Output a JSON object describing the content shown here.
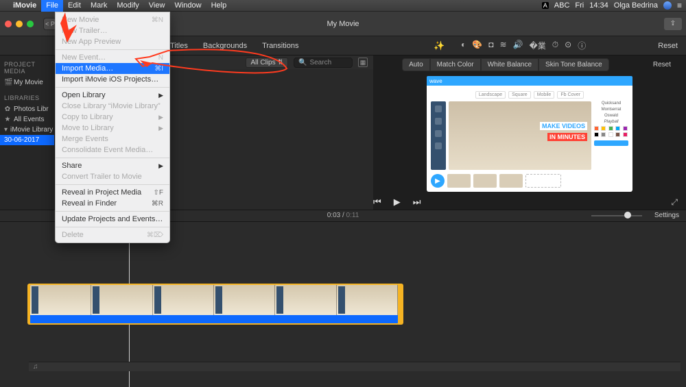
{
  "menubar": {
    "app": "iMovie",
    "items": [
      "File",
      "Edit",
      "Mark",
      "Modify",
      "View",
      "Window",
      "Help"
    ],
    "right": {
      "abc": "ABC",
      "day": "Fri",
      "time": "14:34",
      "user": "Olga Bedrina"
    }
  },
  "window": {
    "title": "My Movie",
    "tabs": [
      "Titles",
      "Backgrounds",
      "Transitions"
    ],
    "allclips": "All Clips",
    "search_placeholder": "Search",
    "reset": "Reset",
    "color_tabs": [
      "Auto",
      "Match Color",
      "White Balance",
      "Skin Tone Balance"
    ],
    "color_reset": "Reset"
  },
  "sidebar": {
    "proj_head": "PROJECT MEDIA",
    "proj_item": "My Movie",
    "lib_head": "LIBRARIES",
    "photos": "Photos Libr",
    "allevents": "All Events",
    "imovie_lib": "iMovie Library",
    "date": "30-06-2017"
  },
  "preview": {
    "brand": "wave",
    "tabs": [
      "Landscape",
      "Square",
      "Mobile",
      "Fb Cover"
    ],
    "caption1": "MAKE VIDEOS",
    "caption2": "IN MINUTES",
    "fonts": [
      "Quicksand",
      "Montserrat",
      "Oswald",
      "Playball"
    ]
  },
  "transport": {
    "time": "0:03",
    "dur": "0:11"
  },
  "ruler": {
    "settings": "Settings"
  },
  "filemenu": {
    "new_movie": "New Movie",
    "new_trailer": "New Trailer…",
    "new_app_preview": "New App Preview",
    "new_event": "New Event…",
    "import_media": "Import Media…",
    "import_ios": "Import iMovie iOS Projects…",
    "open_library": "Open Library",
    "close_library": "Close Library “iMovie Library”",
    "copy_to": "Copy to Library",
    "move_to": "Move to Library",
    "merge": "Merge Events",
    "consolidate": "Consolidate Event Media…",
    "share": "Share",
    "convert": "Convert Trailer to Movie",
    "reveal_proj": "Reveal in Project Media",
    "reveal_finder": "Reveal in Finder",
    "update": "Update Projects and Events…",
    "delete": "Delete",
    "sc_new_movie": "⌘N",
    "sc_new_event": "N",
    "sc_import": "⌘I",
    "sc_reveal_proj": "⇧F",
    "sc_reveal_finder": "⌘R",
    "sc_delete": "⌘⌦"
  }
}
